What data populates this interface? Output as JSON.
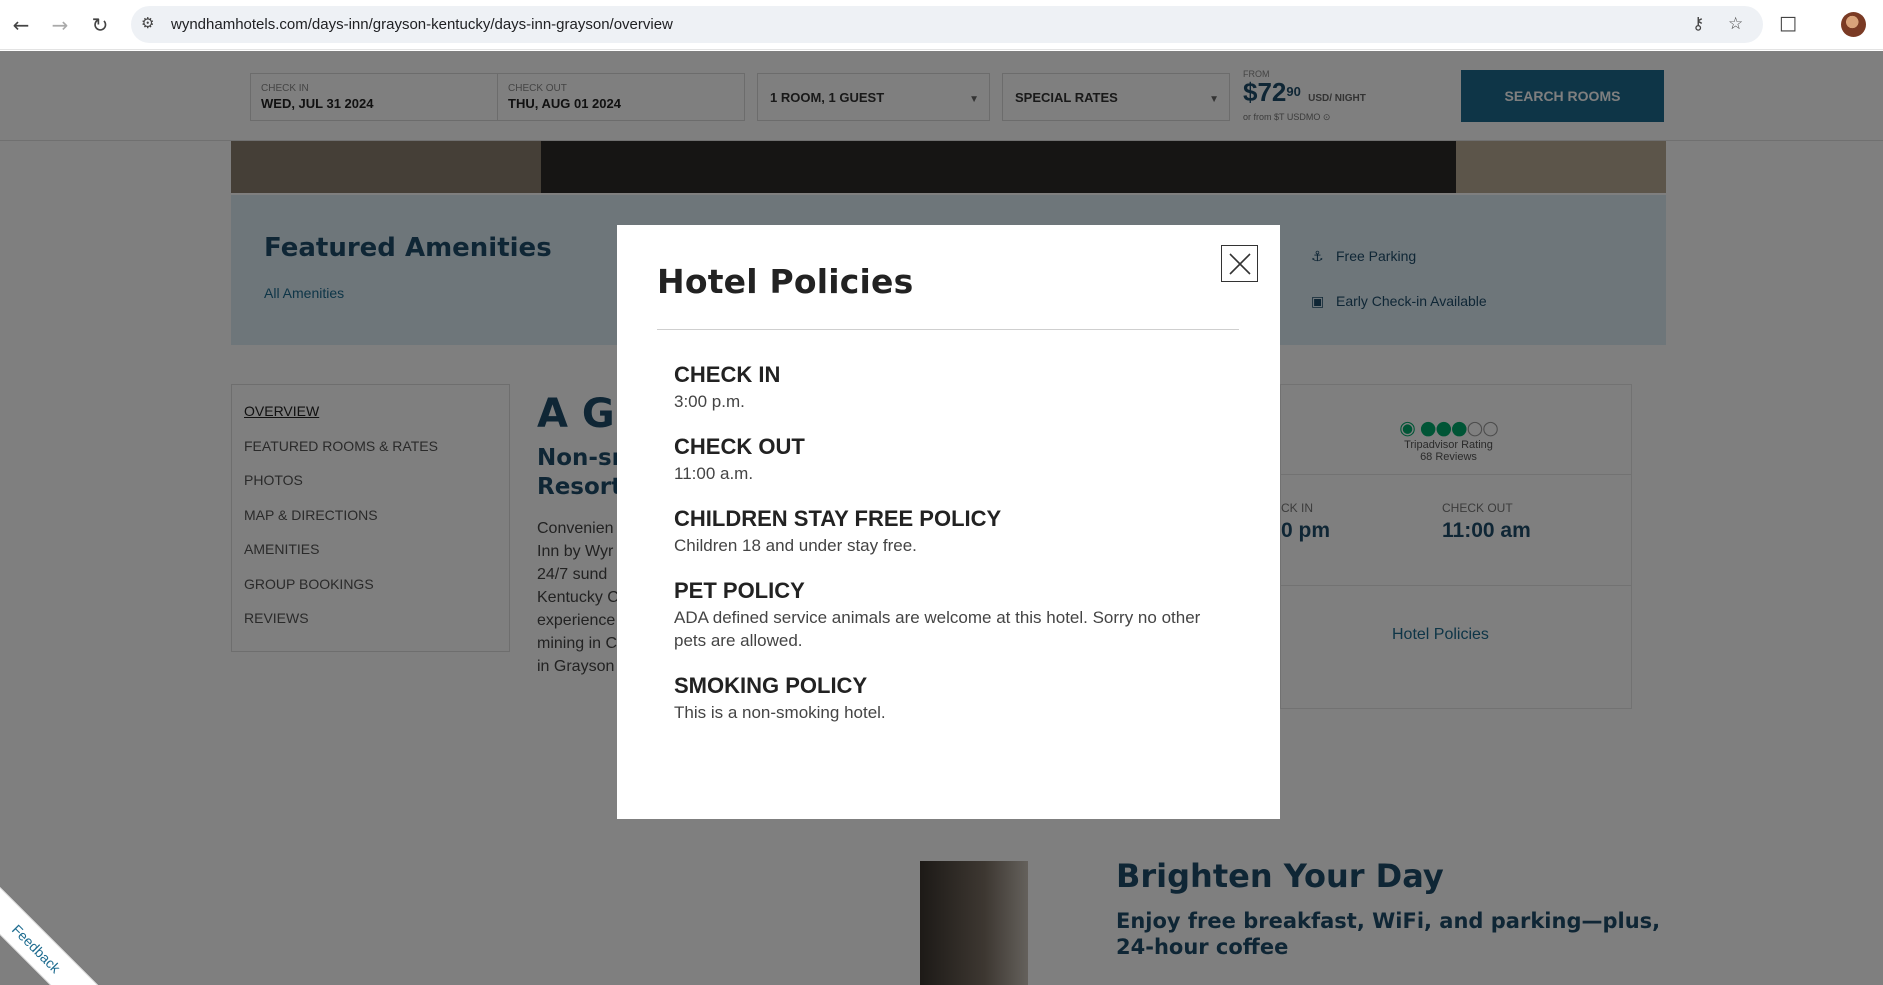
{
  "browser": {
    "url": "wyndhamhotels.com/days-inn/grayson-kentucky/days-inn-grayson/overview"
  },
  "booking_bar": {
    "check_in_caption": "CHECK IN",
    "check_in_value": "WED, JUL 31 2024",
    "check_out_caption": "CHECK OUT",
    "check_out_value": "THU, AUG 01 2024",
    "rooms_guests": "1 ROOM, 1 GUEST",
    "special_rates": "SPECIAL RATES",
    "price_from": "FROM",
    "price_dollars": "$72",
    "price_cents": "90",
    "price_unit": "USD/ NIGHT",
    "price_alt": "or from $T USDMO ⊙",
    "search_label": "SEARCH ROOMS"
  },
  "amenities": {
    "title": "Featured Amenities",
    "all_link": "All Amenities",
    "items": [
      {
        "label": "Free Parking",
        "icon": "car-icon"
      },
      {
        "label": "Early Check-in Available",
        "icon": "luggage-icon"
      }
    ]
  },
  "subnav": {
    "items": [
      "OVERVIEW",
      "FEATURED ROOMS & RATES",
      "PHOTOS",
      "MAP & DIRECTIONS",
      "AMENITIES",
      "GROUP BOOKINGS",
      "REVIEWS"
    ]
  },
  "article": {
    "title": "A Gr",
    "subtitle": "Non-sr Resort",
    "body": "Convenien Inn by Wyr 24/7 sund Kentucky C experience mining in C in Grayson"
  },
  "info_card": {
    "tripadvisor_rating": 3,
    "tripadvisor_max": 5,
    "tripadvisor_label": "Tripadvisor Rating",
    "tripadvisor_reviews": "68 Reviews",
    "check_in_caption": "CK IN",
    "check_in_value": "0 pm",
    "check_out_caption": "CHECK OUT",
    "check_out_value": "11:00 am",
    "policies_link": "Hotel Policies"
  },
  "brighten": {
    "title": "Brighten Your Day",
    "subtitle": "Enjoy free breakfast, WiFi, and parking—plus, 24-hour coffee"
  },
  "feedback_label": "Feedback",
  "modal": {
    "title": "Hotel Policies",
    "policies": [
      {
        "title": "CHECK IN",
        "text": "3:00 p.m."
      },
      {
        "title": "CHECK OUT",
        "text": "11:00 a.m."
      },
      {
        "title": "CHILDREN STAY FREE POLICY",
        "text": "Children 18 and under stay free."
      },
      {
        "title": "PET POLICY",
        "text": "ADA defined service animals are welcome at this hotel. Sorry no other pets are allowed."
      },
      {
        "title": "SMOKING POLICY",
        "text": "This is a non-smoking hotel."
      }
    ]
  }
}
